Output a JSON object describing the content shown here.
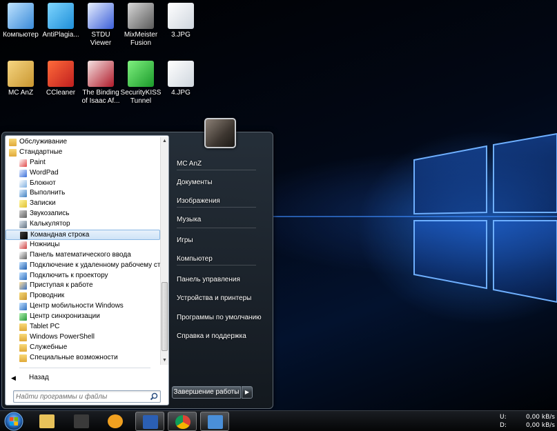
{
  "desktop": {
    "icons": [
      {
        "label": "Компьютер",
        "icon": "computer-icon"
      },
      {
        "label": "AntiPlagia...",
        "icon": "antiplagiat-icon"
      },
      {
        "label": "STDU Viewer",
        "icon": "stdu-viewer-icon"
      },
      {
        "label": "MixMeister Fusion",
        "icon": "mixmeister-icon"
      },
      {
        "label": "3.JPG",
        "icon": "image-file-icon"
      },
      {
        "label": "MC AnZ",
        "icon": "user-folder-icon"
      },
      {
        "label": "CCleaner",
        "icon": "ccleaner-icon"
      },
      {
        "label": "The Binding of Isaac Af...",
        "icon": "isaac-icon"
      },
      {
        "label": "SecurityKISS Tunnel",
        "icon": "securitykiss-icon"
      },
      {
        "label": "4.JPG",
        "icon": "image-file-icon"
      }
    ]
  },
  "start_menu": {
    "programs": [
      {
        "label": "Обслуживание",
        "level": 0,
        "icon": "folder-icon"
      },
      {
        "label": "Стандартные",
        "level": 0,
        "icon": "folder-icon"
      },
      {
        "label": "Paint",
        "level": 1,
        "icon": "paint-icon"
      },
      {
        "label": "WordPad",
        "level": 1,
        "icon": "wordpad-icon"
      },
      {
        "label": "Блокнот",
        "level": 1,
        "icon": "notepad-icon"
      },
      {
        "label": "Выполнить",
        "level": 1,
        "icon": "run-icon"
      },
      {
        "label": "Записки",
        "level": 1,
        "icon": "sticky-notes-icon"
      },
      {
        "label": "Звукозапись",
        "level": 1,
        "icon": "sound-recorder-icon"
      },
      {
        "label": "Калькулятор",
        "level": 1,
        "icon": "calculator-icon"
      },
      {
        "label": "Командная строка",
        "level": 1,
        "icon": "cmd-icon",
        "selected": true
      },
      {
        "label": "Ножницы",
        "level": 1,
        "icon": "scissors-icon"
      },
      {
        "label": "Панель математического ввода",
        "level": 1,
        "icon": "math-input-icon"
      },
      {
        "label": "Подключение к удаленному рабочему столу",
        "level": 1,
        "icon": "remote-desktop-icon"
      },
      {
        "label": "Подключить к проектору",
        "level": 1,
        "icon": "projector-icon"
      },
      {
        "label": "Приступая к работе",
        "level": 1,
        "icon": "getting-started-icon"
      },
      {
        "label": "Проводник",
        "level": 1,
        "icon": "explorer-icon"
      },
      {
        "label": "Центр мобильности Windows",
        "level": 1,
        "icon": "mobility-center-icon"
      },
      {
        "label": "Центр синхронизации",
        "level": 1,
        "icon": "sync-center-icon"
      },
      {
        "label": "Tablet PC",
        "level": 1,
        "icon": "folder-icon"
      },
      {
        "label": "Windows PowerShell",
        "level": 1,
        "icon": "folder-icon"
      },
      {
        "label": "Служебные",
        "level": 1,
        "icon": "folder-icon"
      },
      {
        "label": "Специальные возможности",
        "level": 1,
        "icon": "folder-icon"
      }
    ],
    "back_label": "Назад",
    "search_placeholder": "Найти программы и файлы",
    "right_items": [
      "MC AnZ",
      "Документы",
      "Изображения",
      "Музыка",
      "Игры",
      "Компьютер",
      "Панель управления",
      "Устройства и принтеры",
      "Программы по умолчанию",
      "Справка и поддержка"
    ],
    "shutdown_label": "Завершение работы"
  },
  "taskbar": {
    "buttons": [
      {
        "name": "file-manager-icon",
        "color": "#e8c25a",
        "open": false
      },
      {
        "name": "mpc-be-icon",
        "color": "#3a3a3a",
        "open": false
      },
      {
        "name": "aimp-icon",
        "color": "#f0a020",
        "open": false
      },
      {
        "name": "word-icon",
        "color": "#2b5fb4",
        "open": true
      },
      {
        "name": "chrome-icon",
        "color": "#4caf50",
        "open": true
      },
      {
        "name": "remote-desktop-icon",
        "color": "#4a8fd8",
        "open": true
      }
    ],
    "net": {
      "upload_label": "U:",
      "upload_value": "0,00 kB/s",
      "download_label": "D:",
      "download_value": "0,00 kB/s"
    }
  }
}
